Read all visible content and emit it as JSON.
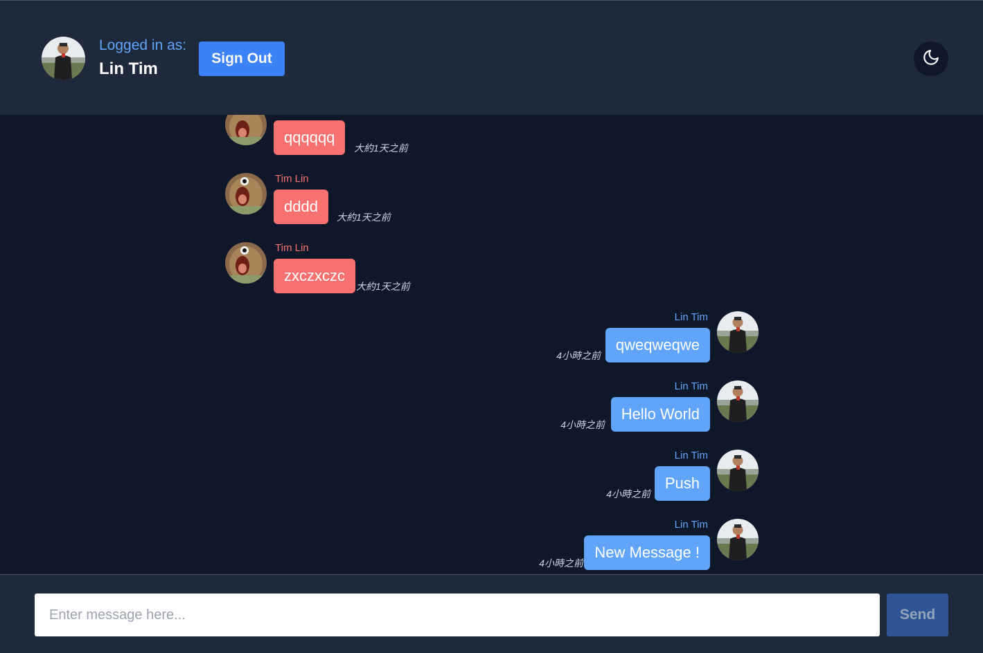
{
  "header": {
    "logged_in_label": "Logged in as:",
    "user_name": "Lin Tim",
    "sign_out_label": "Sign Out",
    "theme_icon": "moon-icon"
  },
  "messages": [
    {
      "author": "",
      "text": "qqqqqq",
      "time": "大約1天之前",
      "side": "other"
    },
    {
      "author": "Tim Lin",
      "text": "dddd",
      "time": "大約1天之前",
      "side": "other"
    },
    {
      "author": "Tim Lin",
      "text": "zxczxczc",
      "time": "大約1天之前",
      "side": "other"
    },
    {
      "author": "Lin Tim",
      "text": "qweqweqwe",
      "time": "4小時之前",
      "side": "mine"
    },
    {
      "author": "Lin Tim",
      "text": "Hello World",
      "time": "4小時之前",
      "side": "mine"
    },
    {
      "author": "Lin Tim",
      "text": "Push",
      "time": "4小時之前",
      "side": "mine"
    },
    {
      "author": "Lin Tim",
      "text": "New Message !",
      "time": "4小時之前",
      "side": "mine"
    }
  ],
  "composer": {
    "placeholder": "Enter message here...",
    "value": "",
    "send_label": "Send"
  },
  "colors": {
    "header_bg": "#1e293b",
    "chat_bg": "#0f172a",
    "other_bubble": "#f87171",
    "mine_bubble": "#60a5fa",
    "accent": "#3b82f6"
  }
}
